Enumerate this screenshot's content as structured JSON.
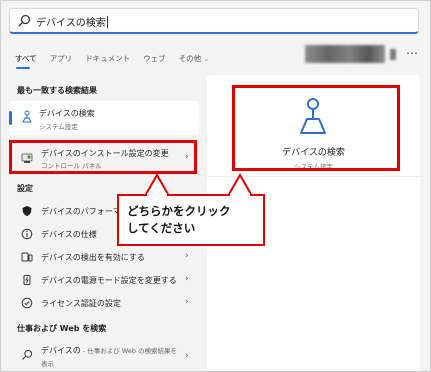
{
  "search": {
    "value": "デバイスの検索"
  },
  "tabs": [
    {
      "label": "すべて"
    },
    {
      "label": "アプリ"
    },
    {
      "label": "ドキュメント"
    },
    {
      "label": "ウェブ"
    },
    {
      "label": "その他"
    }
  ],
  "best_match": {
    "section_title": "最も一致する検索結果",
    "title": "デバイスの検索",
    "subtitle": "システム設定"
  },
  "device_install": {
    "title": "デバイスのインストール設定の変更",
    "subtitle": "コントロール パネル"
  },
  "settings": {
    "section_title": "設定",
    "items": [
      {
        "label": "デバイスのパフォーマンスと正常性",
        "icon": "shield-icon"
      },
      {
        "label": "デバイスの仕様",
        "icon": "info-icon"
      },
      {
        "label": "デバイスの検出を有効にする",
        "icon": "device-icon"
      },
      {
        "label": "デバイスの電源モード設定を変更する",
        "icon": "power-icon"
      },
      {
        "label": "ライセンス認証の設定",
        "icon": "check-circle-icon"
      }
    ]
  },
  "web": {
    "section_title": "仕事および Web を検索",
    "query": "デバイスの",
    "note": " - 仕事および Web の検索結果を",
    "note2": "表示"
  },
  "panel": {
    "title": "デバイスの検索",
    "subtitle": "システム設定"
  },
  "callout": {
    "line1": "どちらかをクリック",
    "line2": "してください"
  },
  "colors": {
    "accent": "#2f6fd0",
    "highlight_red": "#e30000"
  }
}
